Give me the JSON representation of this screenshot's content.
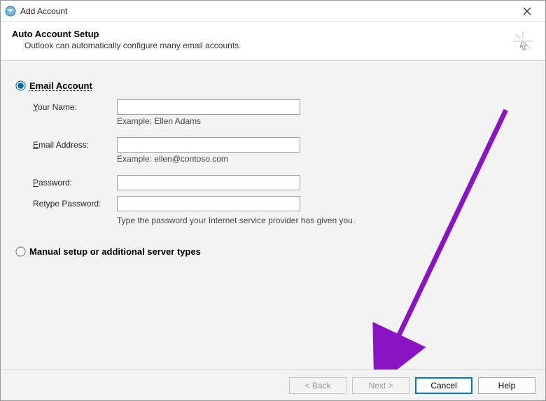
{
  "window": {
    "title": "Add Account"
  },
  "header": {
    "title": "Auto Account Setup",
    "subtitle": "Outlook can automatically configure many email accounts."
  },
  "options": {
    "email_account_label": "Email Account",
    "manual_label": "Manual setup or additional server types"
  },
  "form": {
    "your_name": {
      "label_pre": "",
      "label": "Your Name:",
      "underline": "Y",
      "value": "",
      "hint": "Example: Ellen Adams"
    },
    "email": {
      "label": "Email Address:",
      "underline": "E",
      "value": "",
      "hint": "Example: ellen@contoso.com"
    },
    "password": {
      "label": "Password:",
      "underline": "P",
      "value": ""
    },
    "retype": {
      "label": "Retype Password:",
      "value": ""
    },
    "password_hint": "Type the password your Internet service provider has given you."
  },
  "buttons": {
    "back": "< Back",
    "next": "Next >",
    "cancel": "Cancel",
    "help": "Help"
  },
  "annotation": {
    "arrow_color": "#8a14c4"
  }
}
